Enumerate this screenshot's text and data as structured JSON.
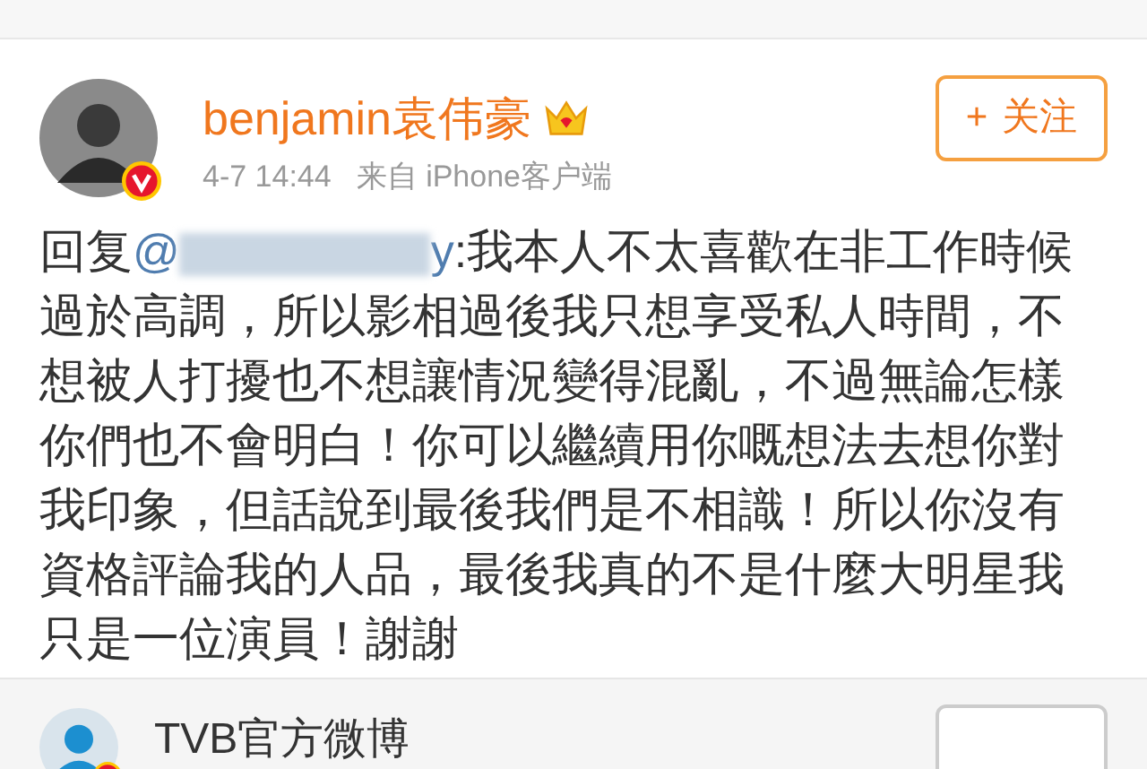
{
  "post": {
    "author": "benjamin袁伟豪",
    "vip": true,
    "verified": true,
    "time": "4-7 14:44",
    "source": "来自 iPhone客户端",
    "follow_button": {
      "plus": "+",
      "label": "关注"
    },
    "reply_prefix": "回复",
    "mention_start": "@",
    "mention_end": "y",
    "body": ":我本人不太喜歡在非工作時候過於高調，所以影相過後我只想享受私人時間，不想被人打擾也不想讓情況變得混亂，不過無論怎樣你們也不會明白！你可以繼續用你嘅想法去想你對我印象，但話說到最後我們是不相識！所以你沒有資格評論我的人品，最後我真的不是什麼大明星我只是一位演員！謝謝"
  },
  "next_post": {
    "author": "TVB官方微博",
    "verified": true
  }
}
